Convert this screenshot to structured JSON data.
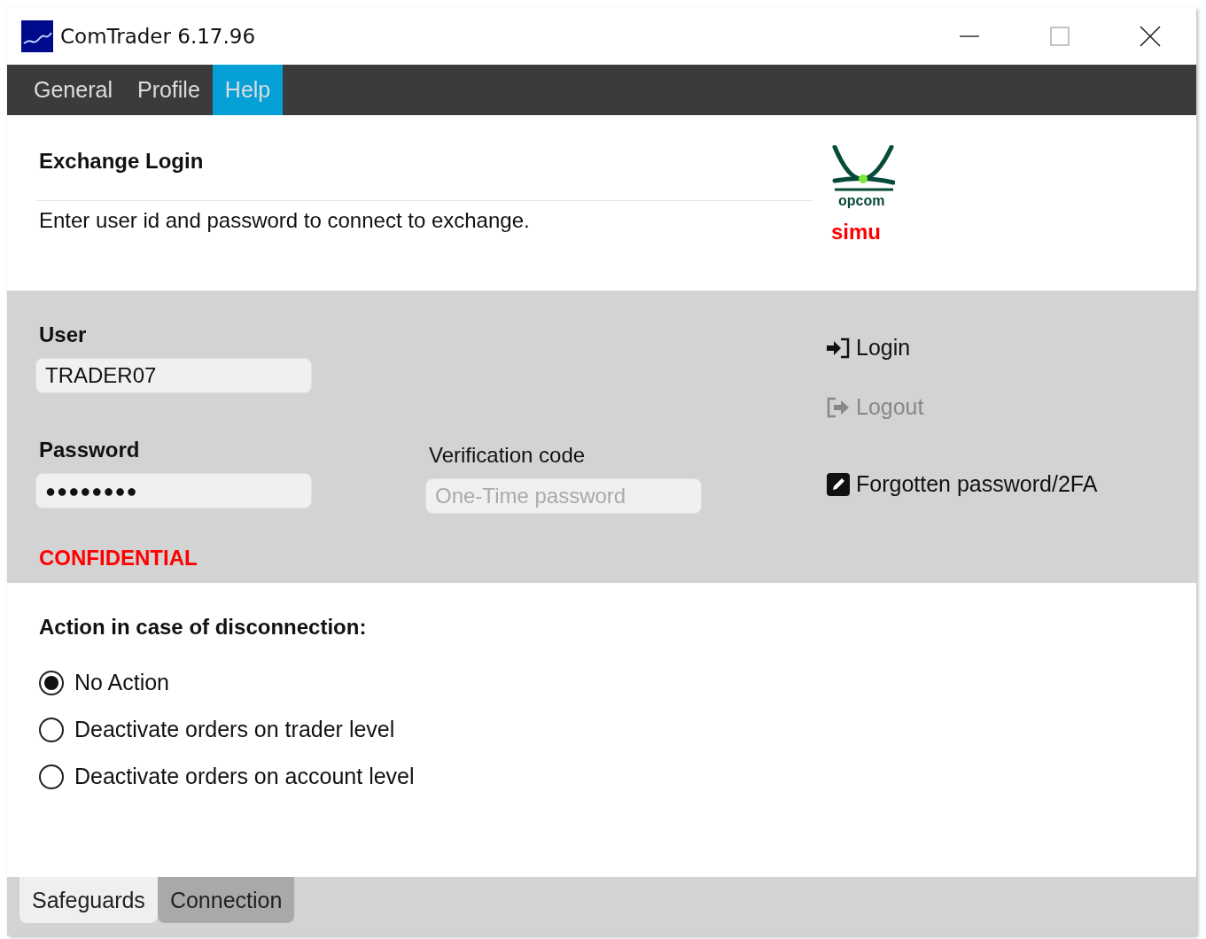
{
  "window": {
    "title": "ComTrader 6.17.96"
  },
  "menu": [
    {
      "label": "General",
      "selected": false
    },
    {
      "label": "Profile",
      "selected": false
    },
    {
      "label": "Help",
      "selected": true
    }
  ],
  "header": {
    "title": "Exchange Login",
    "description": "Enter user id and password to connect to exchange.",
    "logo_text": "opcom",
    "environment": "simu"
  },
  "login_form": {
    "user": {
      "label": "User",
      "value": "TRADER07"
    },
    "password": {
      "label": "Password",
      "value": "●●●●●●●●"
    },
    "verification": {
      "label": "Verification code",
      "placeholder": "One-Time password"
    },
    "notice": "CONFIDENTIAL"
  },
  "actions": [
    {
      "kind": "login",
      "label": "Login",
      "disabled": false
    },
    {
      "kind": "logout",
      "label": "Logout",
      "disabled": true
    },
    {
      "kind": "forgot",
      "label": "Forgotten password/2FA",
      "disabled": false
    }
  ],
  "disconnection": {
    "title": "Action in case of disconnection:",
    "options": [
      {
        "label": "No Action",
        "selected": true
      },
      {
        "label": "Deactivate orders on trader level",
        "selected": false
      },
      {
        "label": "Deactivate orders on account level",
        "selected": false
      }
    ]
  },
  "bottom_tabs": [
    {
      "label": "Safeguards",
      "selected": false
    },
    {
      "label": "Connection",
      "selected": true
    }
  ]
}
